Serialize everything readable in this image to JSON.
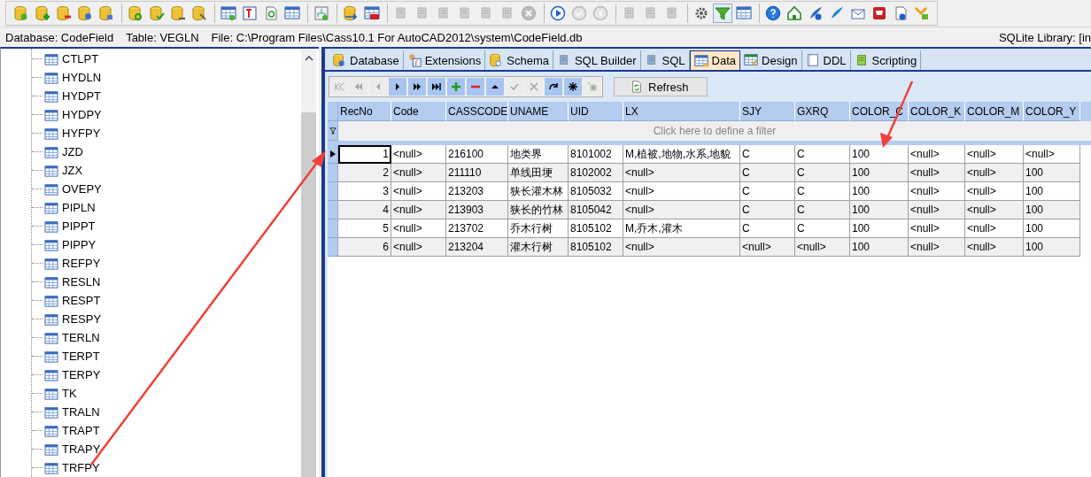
{
  "toolbar": [
    [
      {
        "disabled": false
      },
      {
        "disabled": false
      },
      {
        "disabled": false
      },
      {
        "disabled": false
      },
      {
        "disabled": false
      }
    ],
    [
      {
        "disabled": false
      },
      {
        "disabled": false
      },
      {
        "disabled": false
      },
      {
        "disabled": false
      }
    ],
    [
      {
        "disabled": false
      },
      {
        "disabled": false
      },
      {
        "disabled": false
      },
      {
        "disabled": false
      }
    ],
    [
      {
        "disabled": false
      }
    ],
    [
      {
        "disabled": false
      },
      {
        "disabled": false
      }
    ],
    [
      {
        "disabled": true
      },
      {
        "disabled": true
      },
      {
        "disabled": true
      },
      {
        "disabled": true
      },
      {
        "disabled": true
      },
      {
        "disabled": true
      },
      {
        "disabled": true
      }
    ],
    [
      {
        "disabled": false
      },
      {
        "disabled": true
      },
      {
        "disabled": true
      }
    ],
    [
      {
        "disabled": true
      },
      {
        "disabled": true
      },
      {
        "disabled": true
      }
    ],
    [
      {
        "disabled": false
      },
      {
        "disabled": false,
        "selected": true
      },
      {
        "disabled": false
      }
    ],
    [
      {
        "disabled": false
      },
      {
        "disabled": false
      },
      {
        "disabled": false
      },
      {
        "disabled": false
      },
      {
        "disabled": false
      },
      {
        "disabled": false
      },
      {
        "disabled": false
      },
      {
        "disabled": false
      }
    ]
  ],
  "info_bar": {
    "database": "Database: CodeField",
    "table": "Table: VEGLN",
    "file": "File: C:\\Program Files\\Cass10.1 For AutoCAD2012\\system\\CodeField.db",
    "library": "SQLite Library: [in"
  },
  "tree": {
    "items": [
      {
        "label": "CTLPT"
      },
      {
        "label": "HYDLN"
      },
      {
        "label": "HYDPT"
      },
      {
        "label": "HYDPY"
      },
      {
        "label": "HYFPY"
      },
      {
        "label": "JZD"
      },
      {
        "label": "JZX"
      },
      {
        "label": "OVEPY"
      },
      {
        "label": "PIPLN"
      },
      {
        "label": "PIPPT"
      },
      {
        "label": "PIPPY"
      },
      {
        "label": "REFPY"
      },
      {
        "label": "RESLN"
      },
      {
        "label": "RESPT"
      },
      {
        "label": "RESPY"
      },
      {
        "label": "TERLN"
      },
      {
        "label": "TERPT"
      },
      {
        "label": "TERPY"
      },
      {
        "label": "TK"
      },
      {
        "label": "TRALN"
      },
      {
        "label": "TRAPT"
      },
      {
        "label": "TRAPY"
      },
      {
        "label": "TRFPY"
      }
    ]
  },
  "tabs": [
    {
      "label": "Database",
      "selected": false
    },
    {
      "label": "Extensions",
      "selected": false
    },
    {
      "label": "Schema",
      "selected": false
    },
    {
      "label": "SQL Builder",
      "selected": false
    },
    {
      "label": "SQL",
      "selected": false
    },
    {
      "label": "Data",
      "selected": true
    },
    {
      "label": "Design",
      "selected": false
    },
    {
      "label": "DDL",
      "selected": false
    },
    {
      "label": "Scripting",
      "selected": false
    }
  ],
  "navigator": {
    "buttons": [
      {
        "disabled": true
      },
      {
        "disabled": true
      },
      {
        "disabled": true
      },
      {
        "disabled": false
      },
      {
        "disabled": false
      },
      {
        "disabled": false
      },
      {
        "disabled": false
      },
      {
        "disabled": false
      },
      {
        "disabled": false
      },
      {
        "disabled": true
      },
      {
        "disabled": true
      },
      {
        "disabled": false
      },
      {
        "disabled": false
      },
      {
        "disabled": true
      }
    ],
    "refresh": "Refresh"
  },
  "table": {
    "columns": [
      "RecNo",
      "Code",
      "CASSCODE",
      "UNAME",
      "UID",
      "LX",
      "SJY",
      "GXRQ",
      "COLOR_C",
      "COLOR_K",
      "COLOR_M",
      "COLOR_Y"
    ],
    "filter_placeholder": "Click here to define a filter",
    "rows": [
      {
        "selected": true,
        "cells": [
          "1",
          "<null>",
          "216100",
          "地类界",
          "8101002",
          "M,植被,地物,水系,地貌",
          "C",
          "C",
          "100",
          "<null>",
          "<null>",
          "<null>"
        ]
      },
      {
        "selected": false,
        "cells": [
          "2",
          "<null>",
          "211110",
          "单线田埂",
          "8102002",
          "<null>",
          "C",
          "C",
          "100",
          "<null>",
          "<null>",
          "100"
        ]
      },
      {
        "selected": false,
        "cells": [
          "3",
          "<null>",
          "213203",
          "狭长灌木林",
          "8105032",
          "<null>",
          "C",
          "C",
          "100",
          "<null>",
          "<null>",
          "100"
        ]
      },
      {
        "selected": false,
        "cells": [
          "4",
          "<null>",
          "213903",
          "狭长的竹林",
          "8105042",
          "<null>",
          "C",
          "C",
          "100",
          "<null>",
          "<null>",
          "100"
        ]
      },
      {
        "selected": false,
        "cells": [
          "5",
          "<null>",
          "213702",
          "乔木行树",
          "8105102",
          "M,乔木,灌木",
          "C",
          "C",
          "100",
          "<null>",
          "<null>",
          "100"
        ]
      },
      {
        "selected": false,
        "cells": [
          "6",
          "<null>",
          "213204",
          "灌木行树",
          "8105102",
          "<null>",
          "<null>",
          "<null>",
          "100",
          "<null>",
          "<null>",
          "100"
        ]
      }
    ]
  }
}
